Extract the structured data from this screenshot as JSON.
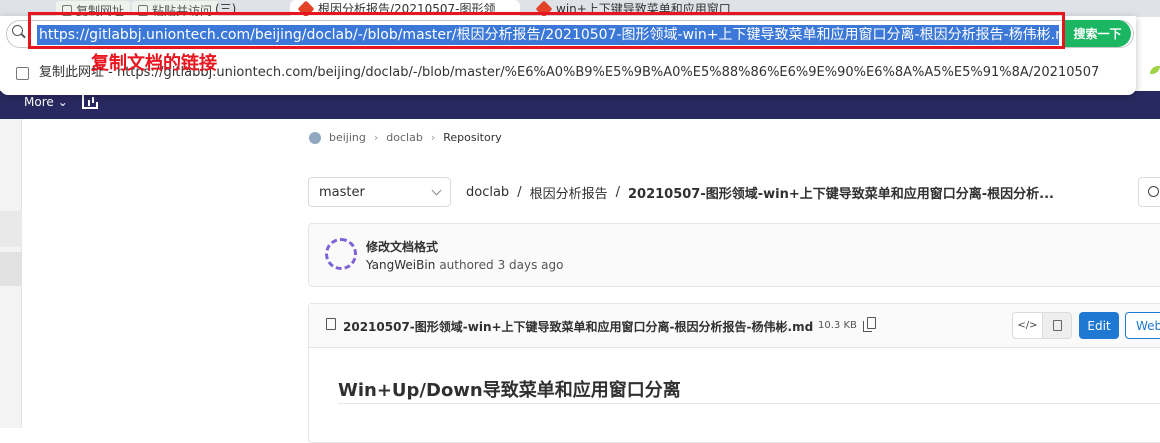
{
  "browser": {
    "toolbar_buttons": [
      "复制网址",
      "粘贴并访问"
    ],
    "tabs": [
      {
        "label": "(三)",
        "active": false
      },
      {
        "label": "根因分析报告/20210507-图形领",
        "active": true
      },
      {
        "label": "win+上下键导致菜单和应用窗口",
        "active": false
      }
    ],
    "address_bar": {
      "url": "https://gitlabbj.uniontech.com/beijing/doclab/-/blob/master/根因分析报告/20210507-图形领域-win+上下键导致菜单和应用窗口分离-根因分析报告-杨伟彬.md",
      "search_button": "搜索一下"
    },
    "suggestion": {
      "text": "复制此网址 - https://gitlabbj.uniontech.com/beijing/doclab/-/blob/master/%E6%A0%B9%E5%9B%A0%E5%88%86%E6%9E%90%E6%8A%A5%E5%91%8A/20210507-%E..."
    },
    "annotation": "复制文档的链接",
    "colors": {
      "highlight": "#3b78d8",
      "annotation_red": "#e8141e",
      "search_green": "#1bb662"
    }
  },
  "gitlab": {
    "nav": {
      "more_label": "More"
    },
    "breadcrumb": [
      "beijing",
      "doclab",
      "Repository"
    ],
    "branch": "master",
    "path": [
      "doclab",
      "根因分析报告",
      "20210507-图形领域-win+上下键导致菜单和应用窗口分离-根因分析..."
    ],
    "commit": {
      "title": "修改文档格式",
      "author": "YangWeiBin",
      "action": "authored",
      "time": "3 days ago"
    },
    "file": {
      "name": "20210507-图形领域-win+上下键导致菜单和应用窗口分离-根因分析报告-杨伟彬.md",
      "size": "10.3 KB",
      "source_label": "</>",
      "edit_label": "Edit",
      "webide_label": "Web"
    },
    "content": {
      "heading": "Win+Up/Down导致菜单和应用窗口分离"
    },
    "colors": {
      "nav_bg": "#292961",
      "primary": "#1f78d1"
    }
  }
}
